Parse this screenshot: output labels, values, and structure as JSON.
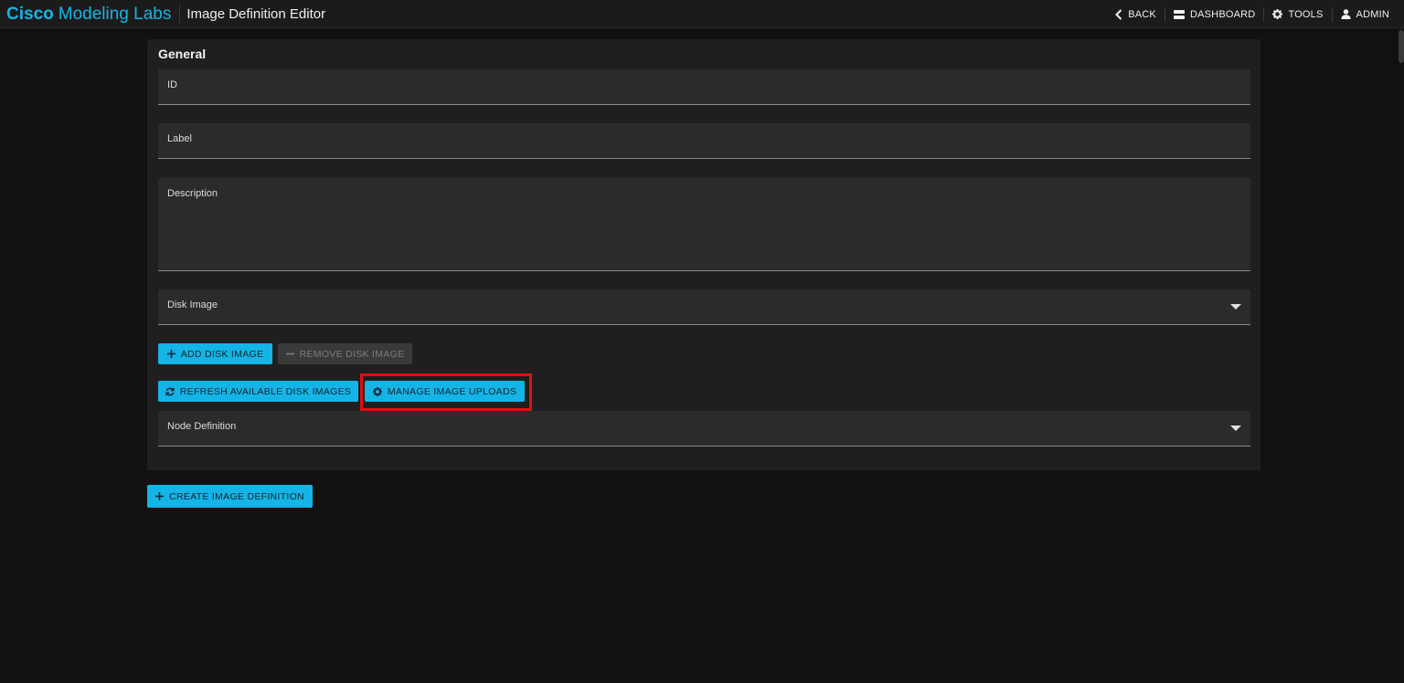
{
  "app": {
    "brand_primary": "Cisco",
    "brand_secondary": "Modeling Labs",
    "page_title": "Image Definition Editor",
    "accent_color": "#14b4e6"
  },
  "nav": {
    "back": "BACK",
    "dashboard": "DASHBOARD",
    "tools": "TOOLS",
    "admin": "ADMIN"
  },
  "general": {
    "section_title": "General",
    "fields": {
      "id_label": "ID",
      "label_label": "Label",
      "description_label": "Description",
      "disk_image_label": "Disk Image",
      "node_definition_label": "Node Definition"
    },
    "buttons": {
      "add_disk_image": "ADD DISK IMAGE",
      "remove_disk_image": "REMOVE DISK IMAGE",
      "refresh_disk_images": "REFRESH AVAILABLE DISK IMAGES",
      "manage_image_uploads": "MANAGE IMAGE UPLOADS"
    }
  },
  "actions": {
    "create_image_definition": "CREATE IMAGE DEFINITION"
  },
  "icons": {
    "back": "chevron-left-icon",
    "dashboard": "dashboard-icon",
    "tools": "gear-icon",
    "admin": "user-icon",
    "add": "plus-icon",
    "remove": "minus-icon",
    "refresh": "refresh-icon",
    "manage": "gear-icon",
    "dropdown": "caret-down-icon"
  },
  "highlight_color": "#e01010"
}
